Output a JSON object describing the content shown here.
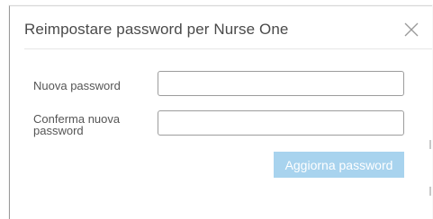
{
  "dialog": {
    "title": "Reimpostare password per Nurse One",
    "close_icon": "close-icon"
  },
  "form": {
    "new_password_label": "Nuova password",
    "new_password_value": "",
    "confirm_password_label": "Conferma nuova password",
    "confirm_password_value": "",
    "submit_label": "Aggiorna password"
  },
  "colors": {
    "submit_button_bg": "#a8d3ee",
    "submit_button_text": "#ffffff",
    "title_text": "#4a4a4a",
    "input_border": "#9c9c9c"
  }
}
